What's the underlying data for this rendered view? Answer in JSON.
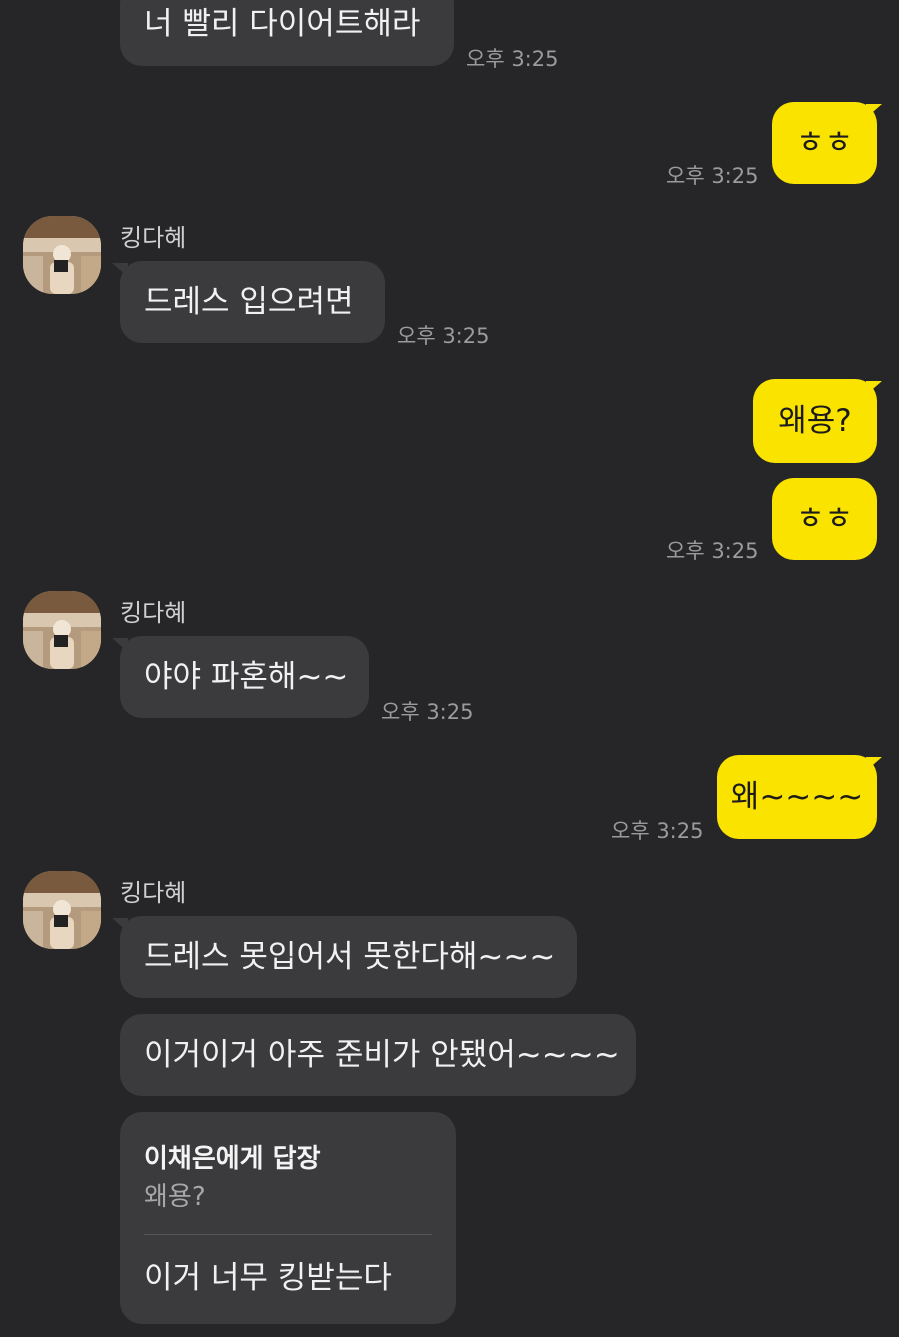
{
  "chat": {
    "sender_name": "킹다혜",
    "messages": [
      {
        "text": "너 빨리 다이어트해라",
        "time": "오후 3:25"
      },
      {
        "text": "ㅎㅎ",
        "time": "오후 3:25"
      },
      {
        "text": "드레스 입으려면",
        "time": "오후 3:25"
      },
      {
        "text": "왜용?"
      },
      {
        "text": "ㅎㅎ",
        "time": "오후 3:25"
      },
      {
        "text": "야야 파혼해~~",
        "time": "오후 3:25"
      },
      {
        "text": "왜~~~~",
        "time": "오후 3:25"
      },
      {
        "text": "드레스 못입어서 못한다해~~~"
      },
      {
        "text": "이거이거 아주 준비가 안됐어~~~~"
      }
    ],
    "reply": {
      "header": "이채은에게 답장",
      "quoted": "왜용?",
      "text": "이거 너무 킹받는다"
    }
  },
  "colors": {
    "background": "#262628",
    "incoming_bubble": "#3b3b3e",
    "outgoing_bubble": "#fbe300",
    "timestamp": "#9b9b9e"
  },
  "icons": {
    "avatar": "profile-photo"
  }
}
